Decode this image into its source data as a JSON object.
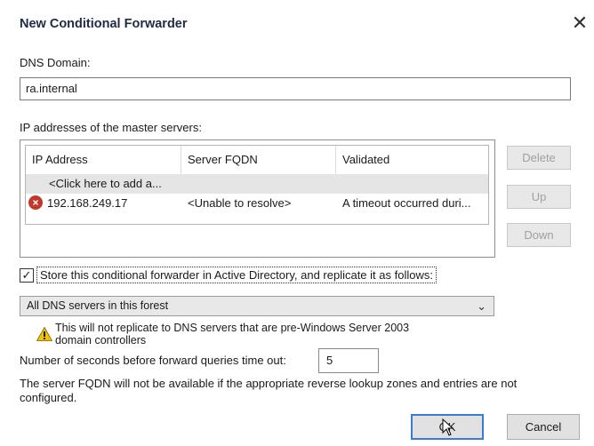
{
  "window": {
    "title": "New Conditional Forwarder",
    "close_glyph": "✕"
  },
  "dns_domain": {
    "label": "DNS Domain:",
    "value": "ra.internal"
  },
  "master_servers": {
    "label": "IP addresses of the master servers:",
    "columns": [
      "IP Address",
      "Server FQDN",
      "Validated"
    ],
    "add_placeholder": "<Click here to add a...",
    "rows": [
      {
        "status_icon": "error-icon",
        "ip": "192.168.249.17",
        "fqdn": "<Unable to resolve>",
        "validated": "A timeout occurred duri..."
      }
    ]
  },
  "side_buttons": {
    "delete": "Delete",
    "up": "Up",
    "down": "Down"
  },
  "store_ad": {
    "checked": true,
    "label": "Store this conditional forwarder in Active Directory, and replicate it as follows:"
  },
  "replication_scope": {
    "selected": "All DNS servers in this forest"
  },
  "warning": {
    "icon": "warning-icon",
    "text": "This will not replicate to DNS servers that are pre-Windows Server 2003\ndomain controllers"
  },
  "timeout": {
    "label": "Number of seconds before forward queries time out:",
    "value": "5"
  },
  "fqdn_note": "The server FQDN will not be available if the appropriate reverse lookup zones and entries are not configured.",
  "footer": {
    "ok": "OK",
    "cancel": "Cancel"
  },
  "colors": {
    "warning": "#f2c200",
    "error": "#c0392b",
    "focus_border": "#3a7bd5"
  }
}
